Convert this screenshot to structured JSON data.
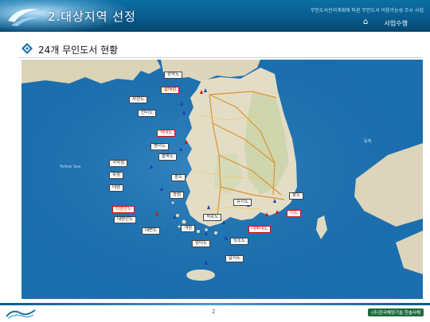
{
  "header": {
    "section_title": "2.대상지역 선정",
    "subtitle": "무인도서관리계획에 따른 무인도서 이용가능성 조사 사업",
    "nav_label": "사업수행"
  },
  "slide": {
    "heading": "24개 무인도서  현황"
  },
  "map": {
    "sea_labels": [
      "Yellow Sea",
      "동해"
    ],
    "islands": [
      {
        "name": "장약도",
        "red": false
      },
      {
        "name": "황해섬",
        "red": true
      },
      {
        "name": "사현도",
        "red": false
      },
      {
        "name": "선미도",
        "red": false
      },
      {
        "name": "석대도",
        "red": true
      },
      {
        "name": "병덕도",
        "red": false
      },
      {
        "name": "황죽도",
        "red": false
      },
      {
        "name": "각작섬",
        "red": false
      },
      {
        "name": "횟섬",
        "red": false
      },
      {
        "name": "대섬",
        "red": false
      },
      {
        "name": "종도",
        "red": false
      },
      {
        "name": "송섬",
        "red": false
      },
      {
        "name": "외령산도",
        "red": true
      },
      {
        "name": "내령산도",
        "red": false
      },
      {
        "name": "내변도",
        "red": false
      },
      {
        "name": "석화도",
        "red": false
      },
      {
        "name": "개섬",
        "red": false
      },
      {
        "name": "유지도",
        "red": false
      },
      {
        "name": "대죽대도",
        "red": true
      },
      {
        "name": "호도",
        "red": false
      },
      {
        "name": "이도",
        "red": true
      },
      {
        "name": "상조도",
        "red": false
      },
      {
        "name": "암미도",
        "red": false
      },
      {
        "name": "달서도",
        "red": false
      }
    ]
  },
  "footer": {
    "page_number": "2",
    "company": "(주)한국해양기술 한솔사해"
  }
}
